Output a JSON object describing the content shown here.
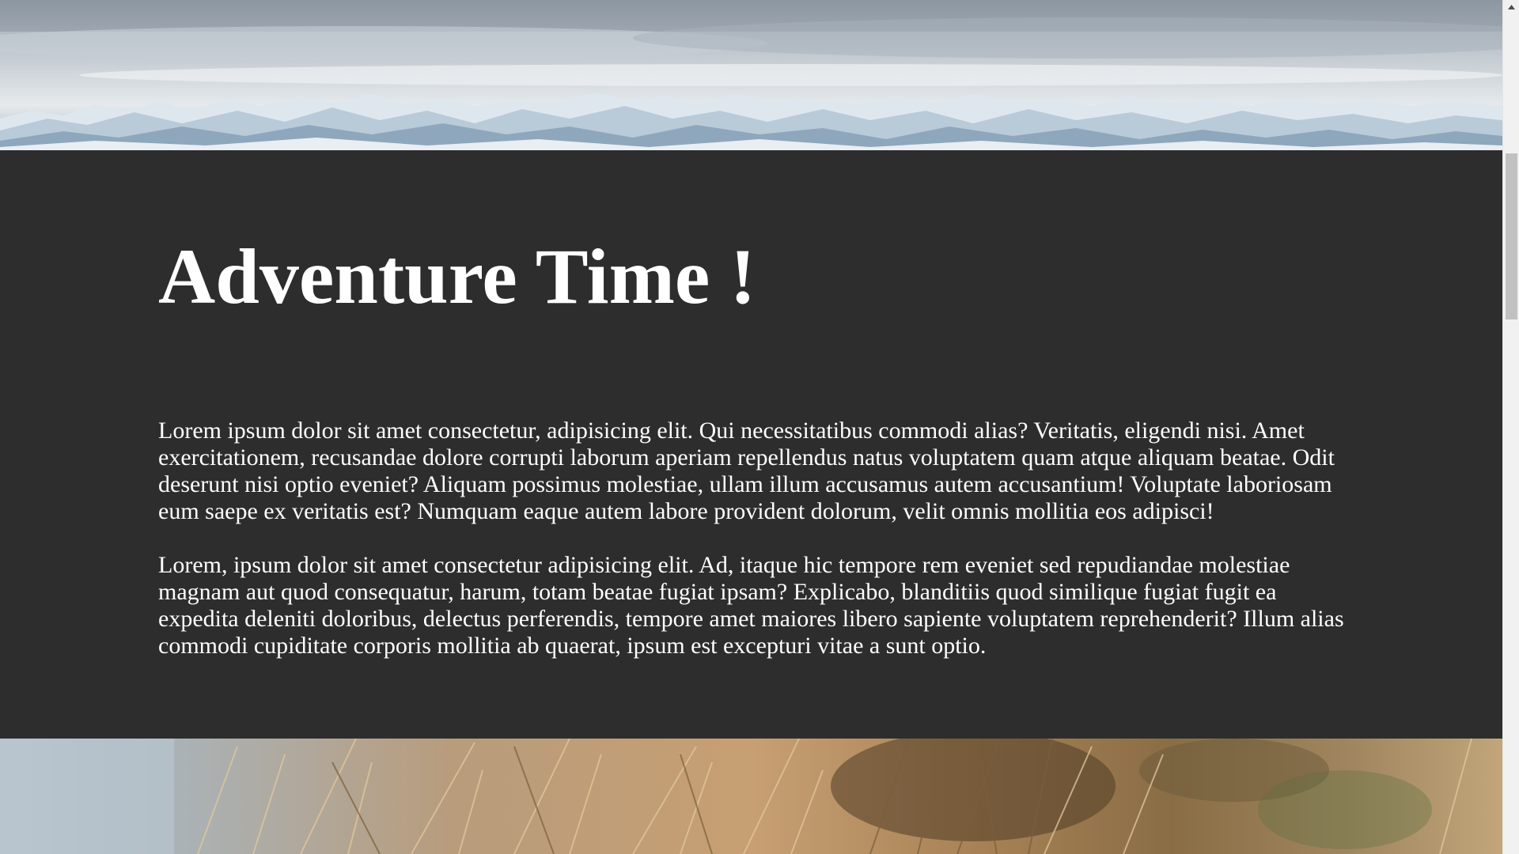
{
  "section": {
    "title": "Adventure Time !",
    "paragraphs": [
      "Lorem ipsum dolor sit amet consectetur, adipisicing elit. Qui necessitatibus commodi alias? Veritatis, eligendi nisi. Amet exercitationem, recusandae dolore corrupti laborum aperiam repellendus natus voluptatem quam atque aliquam beatae. Odit deserunt nisi optio eveniet? Aliquam possimus molestiae, ullam illum accusamus autem accusantium! Voluptate laboriosam eum saepe ex veritatis est? Numquam eaque autem labore provident dolorum, velit omnis mollitia eos adipisci!",
      "Lorem, ipsum dolor sit amet consectetur adipisicing elit. Ad, itaque hic tempore rem eveniet sed repudiandae molestiae magnam aut quod consequatur, harum, totam beatae fugiat ipsam? Explicabo, blanditiis quod similique fugiat fugit ea expedita deleniti doloribus, delectus perferendis, tempore amet maiores libero sapiente voluptatem reprehenderit? Illum alias commodi cupiditate corporis mollitia ab quaerat, ipsum est excepturi vitae a sunt optio."
    ]
  },
  "images": {
    "top": "snowy-mountains-image",
    "bottom": "dry-grass-image"
  },
  "scrollbar": {
    "up_arrow_icon": "chevron-up-icon"
  },
  "colors": {
    "section_background": "#2d2d2d",
    "text": "#ffffff"
  }
}
